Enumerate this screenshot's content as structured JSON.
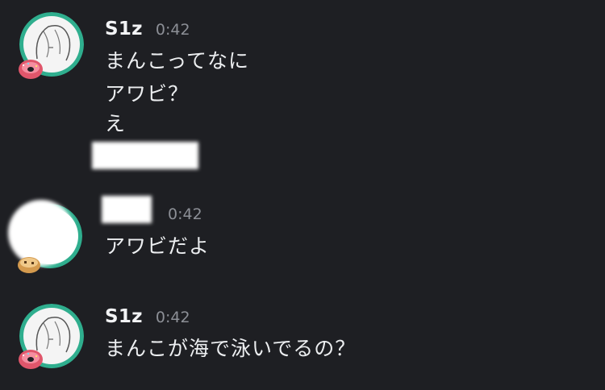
{
  "messages": [
    {
      "author": "S1z",
      "time": "0:42",
      "lines": [
        "まんこってなに",
        "アワビ？",
        "え"
      ]
    },
    {
      "author": "",
      "time": "0:42",
      "lines": [
        "アワビだよ"
      ]
    },
    {
      "author": "S1z",
      "time": "0:42",
      "lines": [
        "まんこが海で泳いでるの？"
      ]
    }
  ],
  "colors": {
    "background": "#1e1f23",
    "text": "#eceef0",
    "timestamp": "#8c8f96",
    "avatar_ring": "#2fae8e",
    "badge_donut": "#e0566b"
  },
  "icons": {
    "avatar_1": "anime-girl-avatar",
    "badge_1": "donut-icon",
    "avatar_2": "redacted-avatar",
    "badge_2": "cookie-icon",
    "avatar_3": "anime-girl-avatar",
    "badge_3": "donut-icon"
  }
}
